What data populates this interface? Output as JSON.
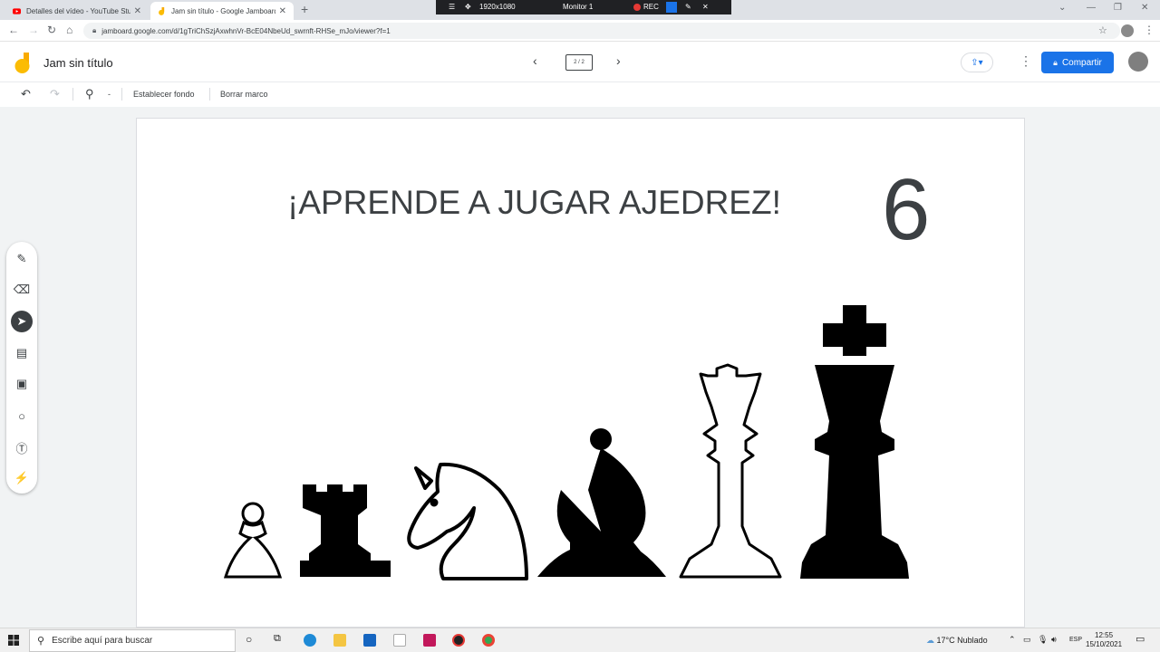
{
  "browser": {
    "tabs": [
      {
        "title": "Detalles del vídeo - YouTube Stu",
        "active": false,
        "favicon": "youtube-icon"
      },
      {
        "title": "Jam sin título - Google Jamboard",
        "active": true,
        "favicon": "jamboard-icon"
      }
    ],
    "new_tab": "+",
    "url": "jamboard.google.com/d/1gTriChSzjAxwhnVr-BcE04NbeUd_swrnft-RHSe_mJo/viewer?f=1"
  },
  "recorder": {
    "resolution": "1920x1080",
    "monitor": "Monitor 1",
    "rec_label": "REC"
  },
  "header": {
    "doc_title": "Jam sin título",
    "frame_indicator": "2 / 2",
    "share_label": "Compartir"
  },
  "toolbar": {
    "zoom_dropdown": "-",
    "set_background": "Establecer fondo",
    "clear_frame": "Borrar marco"
  },
  "canvas": {
    "heading": "¡APRENDE A JUGAR AJEDREZ!",
    "number": "6",
    "pieces": [
      "pawn-white",
      "rook-black",
      "knight-white",
      "bishop-black",
      "queen-white",
      "king-black"
    ]
  },
  "taskbar": {
    "search_placeholder": "Escribe aquí para buscar",
    "weather_temp": "17°C",
    "weather_text": "Nublado",
    "language": "ESP",
    "time": "12:55",
    "date": "15/10/2021"
  },
  "colors": {
    "accent": "#1a73e8",
    "text": "#3c4043",
    "canvas_bg": "#f1f3f4"
  }
}
